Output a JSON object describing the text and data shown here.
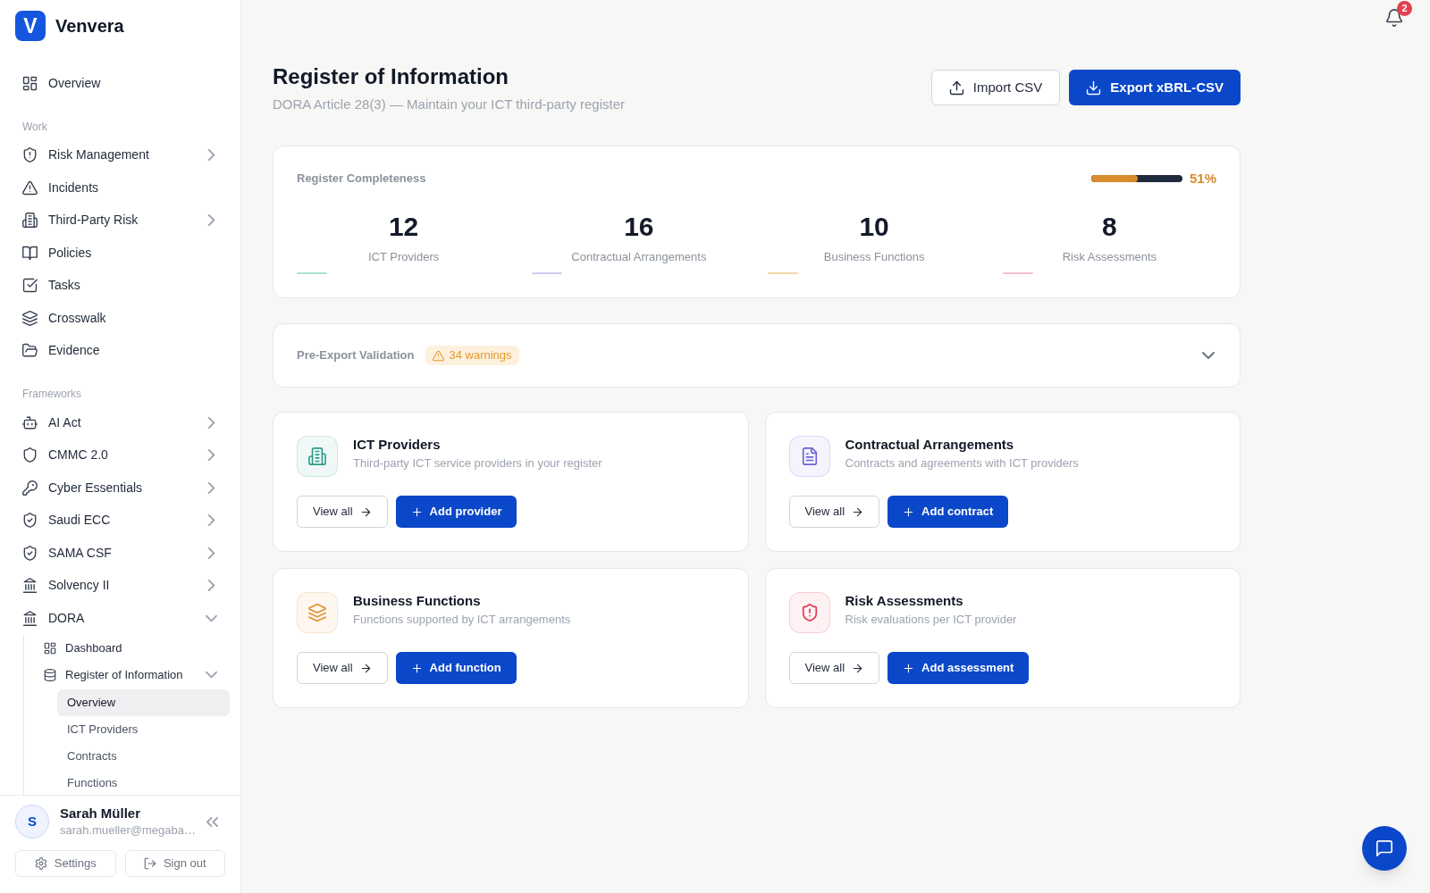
{
  "app": {
    "logo_mark": "V",
    "name": "Venvera"
  },
  "sidebar": {
    "sections": [
      {
        "items": [
          {
            "label": "Overview",
            "kind": "link",
            "selected": false
          }
        ]
      },
      {
        "heading": "Work",
        "items": [
          {
            "label": "Risk Management",
            "kind": "group",
            "expanded": false,
            "selected": false
          },
          {
            "label": "Incidents",
            "kind": "link",
            "selected": false
          },
          {
            "label": "Third-Party Risk",
            "kind": "group",
            "expanded": false,
            "selected": false
          },
          {
            "label": "Policies",
            "kind": "link",
            "selected": false
          },
          {
            "label": "Tasks",
            "kind": "link",
            "selected": false
          },
          {
            "label": "Crosswalk",
            "kind": "link",
            "selected": false
          },
          {
            "label": "Evidence",
            "kind": "link",
            "selected": false
          }
        ]
      },
      {
        "heading": "Frameworks",
        "items": [
          {
            "label": "AI Act",
            "kind": "group",
            "expanded": false,
            "selected": false
          },
          {
            "label": "CMMC 2.0",
            "kind": "group",
            "expanded": false,
            "selected": false
          },
          {
            "label": "Cyber Essentials",
            "kind": "group",
            "expanded": false,
            "selected": false
          },
          {
            "label": "Saudi ECC",
            "kind": "group",
            "expanded": false,
            "selected": false
          },
          {
            "label": "SAMA CSF",
            "kind": "group",
            "expanded": false,
            "selected": false
          },
          {
            "label": "Solvency II",
            "kind": "group",
            "expanded": false,
            "selected": false
          },
          {
            "label": "DORA",
            "kind": "group",
            "expanded": true,
            "selected": false,
            "children": [
              {
                "label": "Dashboard",
                "kind": "link",
                "selected": false
              },
              {
                "label": "Register of Information",
                "kind": "group",
                "expanded": true,
                "selected": false,
                "children": [
                  {
                    "label": "Overview",
                    "kind": "link",
                    "selected": true
                  },
                  {
                    "label": "ICT Providers",
                    "kind": "link",
                    "selected": false
                  },
                  {
                    "label": "Contracts",
                    "kind": "link",
                    "selected": false
                  },
                  {
                    "label": "Functions",
                    "kind": "link",
                    "selected": false
                  }
                ]
              }
            ]
          }
        ]
      }
    ],
    "user": {
      "initial": "S",
      "name": "Sarah Müller",
      "email": "sarah.mueller@megaba…"
    },
    "footer_buttons": [
      {
        "label": "Settings"
      },
      {
        "label": "Sign out"
      }
    ]
  },
  "notifications": {
    "count": "2"
  },
  "header": {
    "title": "Register of Information",
    "subtitle": "DORA Article 28(3) — Maintain your ICT third-party register",
    "actions": [
      {
        "label": "Import CSV",
        "kind": "secondary"
      },
      {
        "label": "Export xBRL-CSV",
        "kind": "primary"
      }
    ]
  },
  "completeness": {
    "title": "Register Completeness",
    "level": 0.51,
    "reading": "51%",
    "stats": [
      {
        "value": "12",
        "label": "ICT Providers",
        "color": "#a8e1d3"
      },
      {
        "value": "16",
        "label": "Contractual Arrangements",
        "color": "#d0ccf2"
      },
      {
        "value": "10",
        "label": "Business Functions",
        "color": "#f6d8a9"
      },
      {
        "value": "8",
        "label": "Risk Assessments",
        "color": "#f7c0cc"
      }
    ]
  },
  "validation": {
    "title": "Pre-Export Validation",
    "badge": "34 warnings",
    "expanded": false
  },
  "cards": [
    {
      "title": "ICT Providers",
      "description": "Third-party ICT service providers in your register",
      "color": "#2a9d87",
      "actions": [
        {
          "label": "View all",
          "kind": "secondary"
        },
        {
          "label": "Add provider",
          "kind": "primary"
        }
      ]
    },
    {
      "title": "Contractual Arrangements",
      "description": "Contracts and agreements with ICT providers",
      "color": "#6c63d9",
      "actions": [
        {
          "label": "View all",
          "kind": "secondary"
        },
        {
          "label": "Add contract",
          "kind": "primary"
        }
      ]
    },
    {
      "title": "Business Functions",
      "description": "Functions supported by ICT arrangements",
      "color": "#e08e2b",
      "actions": [
        {
          "label": "View all",
          "kind": "secondary"
        },
        {
          "label": "Add function",
          "kind": "primary"
        }
      ]
    },
    {
      "title": "Risk Assessments",
      "description": "Risk evaluations per ICT provider",
      "color": "#e0334f",
      "actions": [
        {
          "label": "View all",
          "kind": "secondary"
        },
        {
          "label": "Add assessment",
          "kind": "primary"
        }
      ]
    }
  ]
}
